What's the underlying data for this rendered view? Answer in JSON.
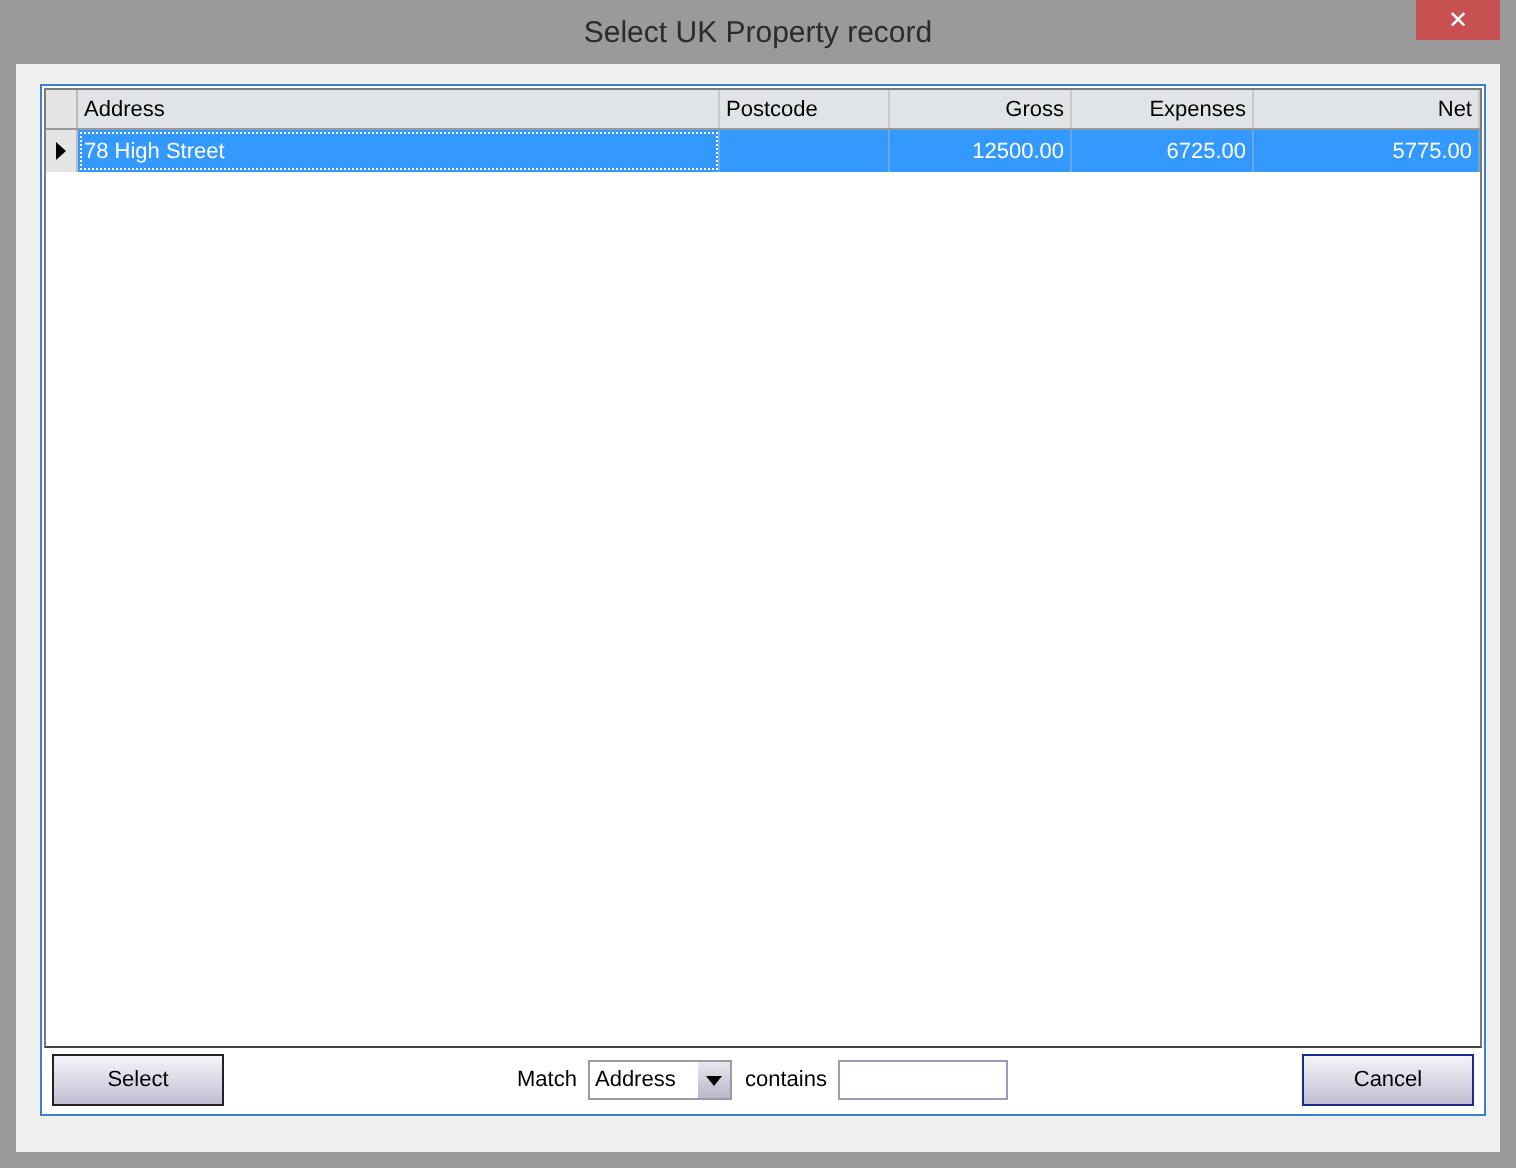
{
  "window": {
    "title": "Select UK Property record",
    "close": "✕"
  },
  "table": {
    "columns": [
      {
        "label": "Address",
        "kind": "text"
      },
      {
        "label": "Postcode",
        "kind": "text"
      },
      {
        "label": "Gross",
        "kind": "amount"
      },
      {
        "label": "Expenses",
        "kind": "amount"
      },
      {
        "label": "Net",
        "kind": "amount"
      }
    ],
    "rows": [
      {
        "selected": true,
        "cells": [
          "78 High Street",
          "",
          "12500.00",
          "6725.00",
          "5775.00"
        ]
      }
    ]
  },
  "footer": {
    "select_button": "Select",
    "match_label": "Match",
    "match_field": "Address",
    "contains_label": "contains",
    "cancel_button": "Cancel"
  }
}
